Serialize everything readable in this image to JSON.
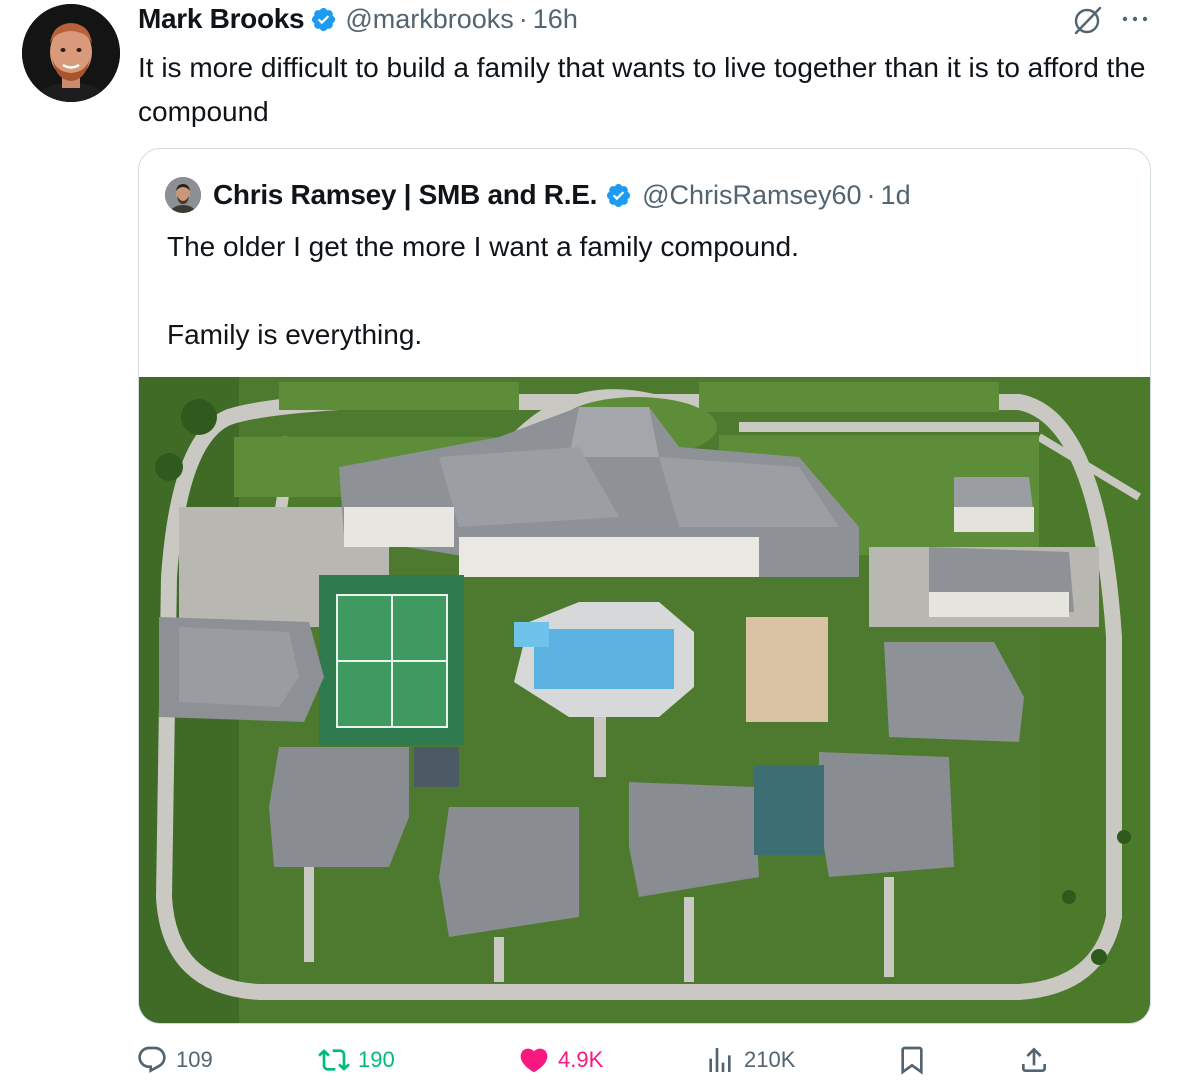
{
  "tweet": {
    "author_name": "Mark Brooks",
    "handle": "@markbrooks",
    "separator": "·",
    "time": "16h",
    "text": "It is more difficult to build a family that wants to live together than it is to afford the compound"
  },
  "quote": {
    "author_name": "Chris Ramsey | SMB and R.E.",
    "handle": "@ChrisRamsey60",
    "separator": "·",
    "time": "1d",
    "line1": "The older I get the more I want a family compound.",
    "line2": "Family is everything.",
    "image_icon": "aerial-photo"
  },
  "actions": {
    "replies": "109",
    "retweets": "190",
    "likes": "4.9K",
    "views": "210K"
  },
  "colors": {
    "verified": "#1d9bf0",
    "retweet_active": "#00ba7c",
    "like_active": "#f91880",
    "muted": "#536471",
    "text": "#0f1419",
    "border": "#cfd9de"
  },
  "icons": [
    "verified-badge-icon",
    "grok-icon",
    "more-options-icon",
    "reply-icon",
    "retweet-icon",
    "heart-icon",
    "views-icon",
    "bookmark-icon",
    "share-icon"
  ]
}
